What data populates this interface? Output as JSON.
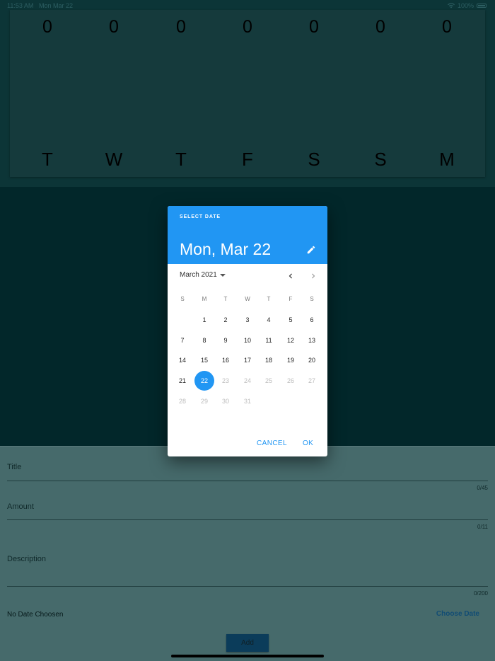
{
  "status_bar": {
    "time": "11:53 AM",
    "date": "Mon Mar 22",
    "battery": "100%"
  },
  "chart": {
    "columns": [
      {
        "amount": "0",
        "day": "T"
      },
      {
        "amount": "0",
        "day": "W"
      },
      {
        "amount": "0",
        "day": "T"
      },
      {
        "amount": "0",
        "day": "F"
      },
      {
        "amount": "0",
        "day": "S"
      },
      {
        "amount": "0",
        "day": "S"
      },
      {
        "amount": "0",
        "day": "M"
      }
    ]
  },
  "form": {
    "title": {
      "label": "Title",
      "counter": "0/45"
    },
    "amount": {
      "label": "Amount",
      "counter": "0/11"
    },
    "description": {
      "label": "Description",
      "counter": "0/200"
    },
    "date_status": "No Date Choosen",
    "choose_date": "Choose Date",
    "add_button": "Add"
  },
  "date_picker": {
    "help_text": "SELECT DATE",
    "selected_date": "Mon, Mar 22",
    "month_label": "March 2021",
    "weekdays": [
      "S",
      "M",
      "T",
      "W",
      "T",
      "F",
      "S"
    ],
    "first_weekday_index": 1,
    "days_in_month": 31,
    "selected_day": 22,
    "last_enabled_day": 22,
    "cancel": "CANCEL",
    "ok": "OK"
  },
  "colors": {
    "accent": "#2196f3"
  },
  "icons": {
    "edit": "pencil-icon",
    "prev": "chevron-left-icon",
    "next": "chevron-right-icon",
    "dropdown": "caret-down-icon"
  }
}
